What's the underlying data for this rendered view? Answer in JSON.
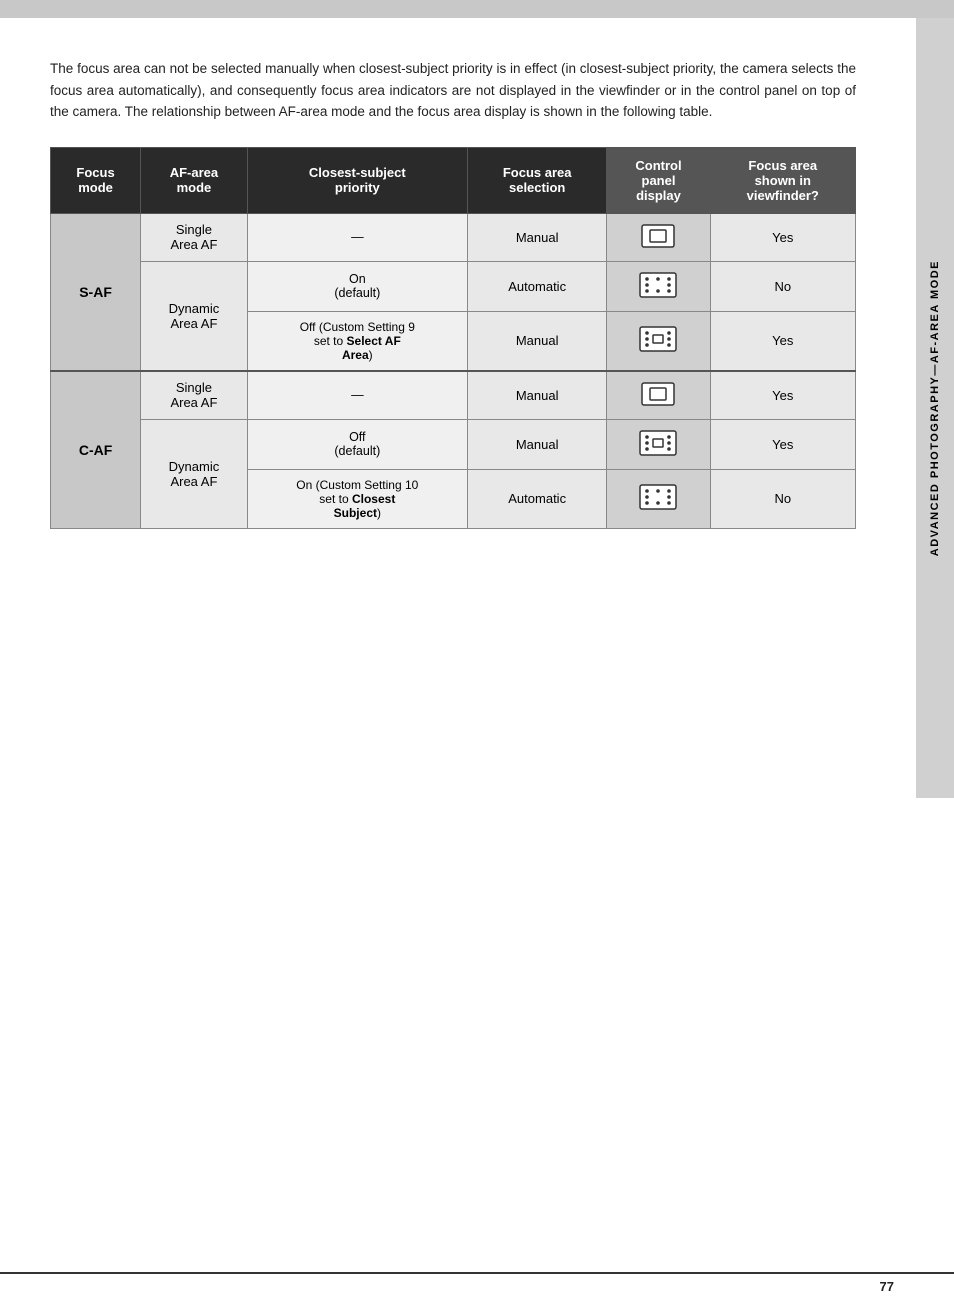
{
  "top_bar": {},
  "sidebar": {
    "text": "ADVANCED PHOTOGRAPHY—AF-AREA MODE"
  },
  "intro": {
    "text": "The focus area can not be selected manually when closest-subject priority is in effect (in closest-subject priority, the camera selects the focus area automatically), and consequently focus area indicators are not displayed in the viewfinder or in the control panel on top of the camera. The relationship between AF-area mode and the focus area display is shown in the following table."
  },
  "table": {
    "headers": [
      "Focus mode",
      "AF-area mode",
      "Closest-subject priority",
      "Focus area selection",
      "Control panel display",
      "Focus area shown in viewfinder?"
    ],
    "rows": [
      {
        "focus_mode": "S-AF",
        "af_area": "Single\nArea AF",
        "closest": "—",
        "focus_sel": "Manual",
        "icon_type": "bracket",
        "viewfinder": "Yes"
      },
      {
        "focus_mode": "",
        "af_area": "Dynamic\nArea AF",
        "closest": "On\n(default)",
        "focus_sel": "Automatic",
        "icon_type": "dots",
        "viewfinder": "No"
      },
      {
        "focus_mode": "",
        "af_area": "",
        "closest": "Off (Custom Setting 9\nset to Select AF\nArea)",
        "focus_sel": "Manual",
        "icon_type": "dots-bracket",
        "viewfinder": "Yes"
      },
      {
        "focus_mode": "C-AF",
        "af_area": "Single\nArea AF",
        "closest": "—",
        "focus_sel": "Manual",
        "icon_type": "bracket",
        "viewfinder": "Yes"
      },
      {
        "focus_mode": "",
        "af_area": "Dynamic\nArea AF",
        "closest": "Off\n(default)",
        "focus_sel": "Manual",
        "icon_type": "dots-bracket",
        "viewfinder": "Yes"
      },
      {
        "focus_mode": "",
        "af_area": "",
        "closest": "On (Custom Setting 10\nset to Closest\nSubject)",
        "focus_sel": "Automatic",
        "icon_type": "dots",
        "viewfinder": "No"
      }
    ]
  },
  "page_number": "77"
}
